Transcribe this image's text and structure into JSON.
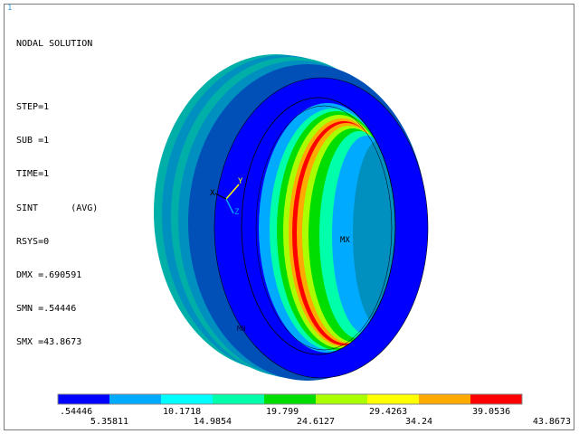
{
  "window_number": "1",
  "header": {
    "title": "NODAL SOLUTION",
    "lines": [
      "STEP=1",
      "SUB =1",
      "TIME=1",
      "SINT      (AVG)",
      "RSYS=0",
      "DMX =.690591",
      "SMN =.54446",
      "SMX =43.8673"
    ]
  },
  "model": {
    "mx_label": "MX",
    "mn_label": "MN",
    "triad": {
      "x": "X",
      "y": "Y",
      "z": "Z"
    }
  },
  "legend": {
    "colors": [
      "#0000ff",
      "#00aaff",
      "#00ffff",
      "#00ffaa",
      "#00dd00",
      "#aaff00",
      "#ffff00",
      "#ffaa00",
      "#ff0000"
    ],
    "top_labels": [
      ".54446",
      "10.1718",
      "19.799",
      "29.4263",
      "39.0536"
    ],
    "bottom_labels": [
      "5.35811",
      "14.9854",
      "24.6127",
      "34.24",
      "43.8673"
    ]
  },
  "colors": {
    "outer_face": "#0000ff",
    "band_dark": "#0050b8",
    "band_mid": "#0090c0",
    "band_light": "#00b0a8",
    "frame": "#7a7a7a"
  }
}
